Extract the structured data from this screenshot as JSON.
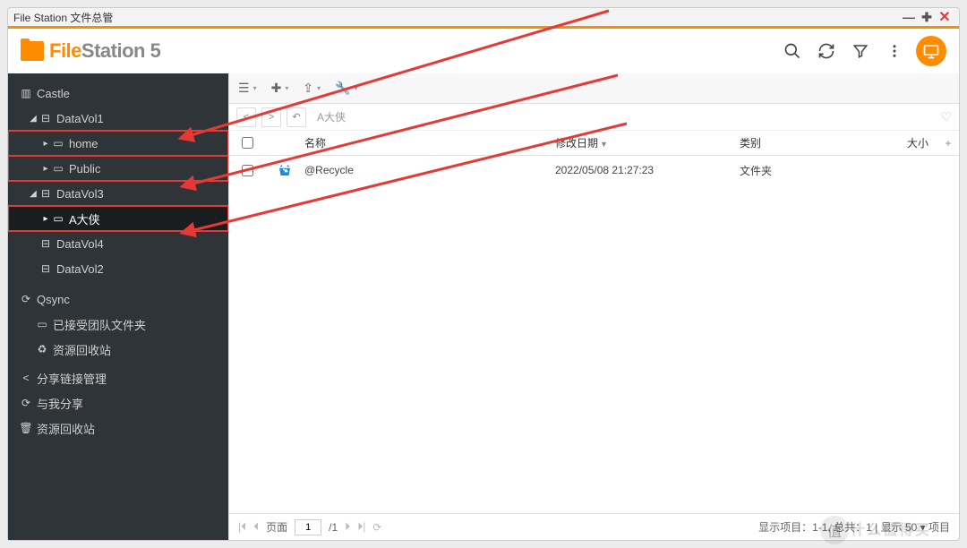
{
  "titlebar": {
    "title": "File Station 文件总管"
  },
  "app": {
    "name_bold": "File",
    "name_light": "Station ",
    "version": "5"
  },
  "sidebar": {
    "castle": "Castle",
    "datavol1": "DataVol1",
    "home": "home",
    "public": "Public",
    "datavol3": "DataVol3",
    "adaxia": "A大侠",
    "datavol4": "DataVol4",
    "datavol2": "DataVol2",
    "qsync": "Qsync",
    "team_folder": "已接受团队文件夹",
    "qsync_recycle": "资源回收站",
    "share_mgmt": "分享链接管理",
    "shared_with_me": "与我分享",
    "recycle_bin": "资源回收站"
  },
  "breadcrumb": {
    "path": "A大侠"
  },
  "columns": {
    "name": "名称",
    "date": "修改日期",
    "type": "类别",
    "size": "大小"
  },
  "rows": [
    {
      "name": "@Recycle",
      "date": "2022/05/08 21:27:23",
      "type": "文件夹",
      "size": ""
    }
  ],
  "status": {
    "page_label": "页面",
    "page_current": "1",
    "page_total": "/1",
    "display": "显示项目：1-1, 总共：1 | 显示 50 ▾ 项目"
  },
  "watermark": "什么值得买"
}
